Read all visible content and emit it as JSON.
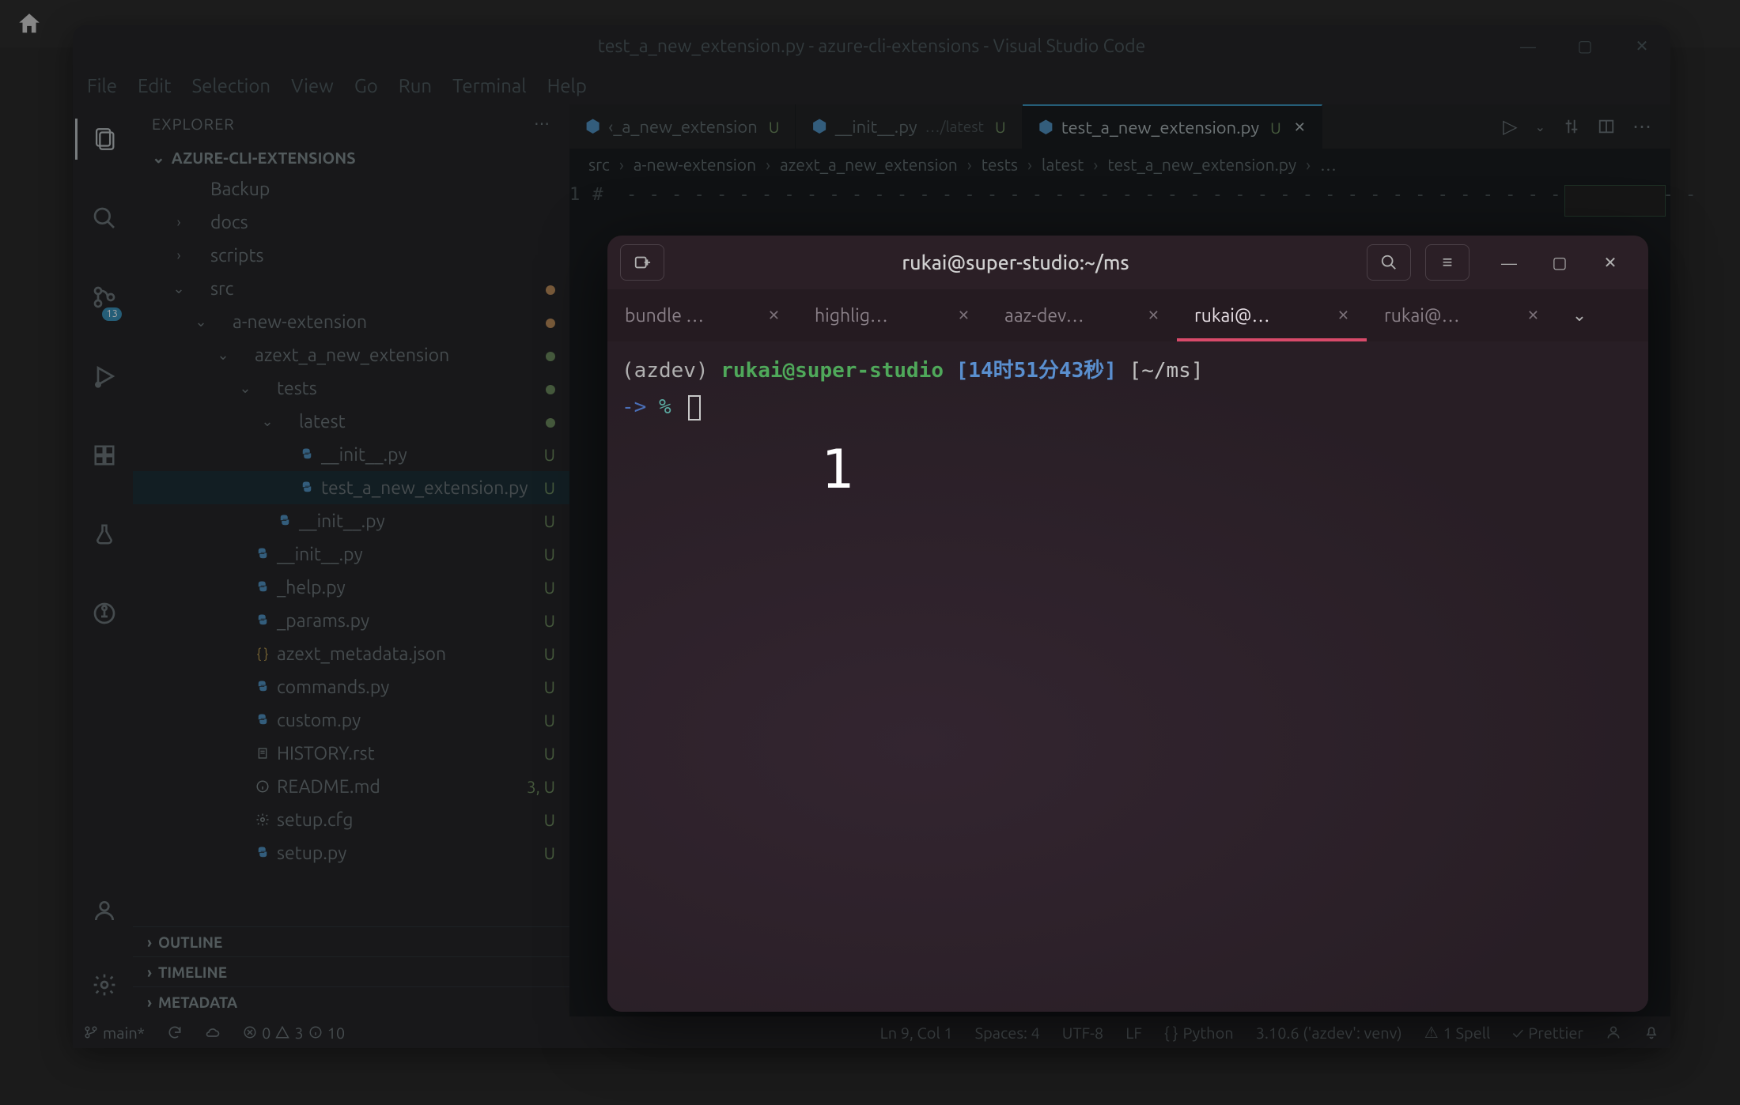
{
  "desktop": {
    "home_icon": "home"
  },
  "window": {
    "title": "test_a_new_extension.py - azure-cli-extensions - Visual Studio Code",
    "menu": [
      "File",
      "Edit",
      "Selection",
      "View",
      "Go",
      "Run",
      "Terminal",
      "Help"
    ]
  },
  "activitybar": {
    "scm_badge": "13"
  },
  "sidebar": {
    "header": "EXPLORER",
    "root": "AZURE-CLI-EXTENSIONS",
    "tree": [
      {
        "indent": 1,
        "chev": "",
        "icon": "",
        "name": "Backup",
        "decor": ""
      },
      {
        "indent": 1,
        "chev": "›",
        "icon": "",
        "name": "docs",
        "decor": ""
      },
      {
        "indent": 1,
        "chev": "›",
        "icon": "",
        "name": "scripts",
        "decor": ""
      },
      {
        "indent": 1,
        "chev": "⌄",
        "icon": "",
        "name": "src",
        "decor": "dot-orange"
      },
      {
        "indent": 2,
        "chev": "⌄",
        "icon": "",
        "name": "a-new-extension",
        "decor": "dot-orange"
      },
      {
        "indent": 3,
        "chev": "⌄",
        "icon": "",
        "name": "azext_a_new_extension",
        "decor": "dot-green"
      },
      {
        "indent": 4,
        "chev": "⌄",
        "icon": "",
        "name": "tests",
        "decor": "dot-green"
      },
      {
        "indent": 5,
        "chev": "⌄",
        "icon": "",
        "name": "latest",
        "decor": "dot-green"
      },
      {
        "indent": 6,
        "chev": "",
        "icon": "py",
        "name": "__init__.py",
        "decor": "U"
      },
      {
        "indent": 6,
        "chev": "",
        "icon": "py",
        "name": "test_a_new_extension.py",
        "decor": "U",
        "sel": true
      },
      {
        "indent": 5,
        "chev": "",
        "icon": "py",
        "name": "__init__.py",
        "decor": "U"
      },
      {
        "indent": 4,
        "chev": "",
        "icon": "py",
        "name": "__init__.py",
        "decor": "U"
      },
      {
        "indent": 4,
        "chev": "",
        "icon": "py",
        "name": "_help.py",
        "decor": "U"
      },
      {
        "indent": 4,
        "chev": "",
        "icon": "py",
        "name": "_params.py",
        "decor": "U"
      },
      {
        "indent": 4,
        "chev": "",
        "icon": "json",
        "name": "azext_metadata.json",
        "decor": "U"
      },
      {
        "indent": 4,
        "chev": "",
        "icon": "py",
        "name": "commands.py",
        "decor": "U"
      },
      {
        "indent": 4,
        "chev": "",
        "icon": "py",
        "name": "custom.py",
        "decor": "U"
      },
      {
        "indent": 4,
        "chev": "",
        "icon": "txt",
        "name": "HISTORY.rst",
        "decor": "U"
      },
      {
        "indent": 4,
        "chev": "",
        "icon": "info",
        "name": "README.md",
        "decor": "3, U"
      },
      {
        "indent": 4,
        "chev": "",
        "icon": "gear",
        "name": "setup.cfg",
        "decor": "U"
      },
      {
        "indent": 4,
        "chev": "",
        "icon": "py",
        "name": "setup.py",
        "decor": "U"
      }
    ],
    "collapsed": [
      "OUTLINE",
      "TIMELINE",
      "METADATA"
    ]
  },
  "tabs": [
    {
      "icon": "py",
      "label": "‹_a_new_extension",
      "suffix": "",
      "u": "U",
      "active": false,
      "close": false
    },
    {
      "icon": "py",
      "label": "__init__.py",
      "suffix": "…/latest",
      "u": "U",
      "active": false,
      "close": false
    },
    {
      "icon": "py",
      "label": "test_a_new_extension.py",
      "suffix": "",
      "u": "U",
      "active": true,
      "close": true
    }
  ],
  "crumbs": [
    "src",
    "a-new-extension",
    "azext_a_new_extension",
    "tests",
    "latest",
    "test_a_new_extension.py",
    "…"
  ],
  "editor": {
    "line_no": "1",
    "code": "#  - - - - - - - - - - - - - - - - - - - - - - - - - - - - - - - - - - - - - - - - - - - - - - - -"
  },
  "status": {
    "branch": "main*",
    "errors": "0",
    "warnings": "3",
    "info": "10",
    "pos": "Ln 9, Col 1",
    "spaces": "Spaces: 4",
    "enc": "UTF-8",
    "eol": "LF",
    "lang": "Python",
    "interp": "3.10.6 ('azdev': venv)",
    "spell": "1 Spell",
    "fmt": "Prettier"
  },
  "terminal": {
    "title": "rukai@super-studio:~/ms",
    "tabs": [
      {
        "label": "bundle …",
        "active": false
      },
      {
        "label": "highlig…",
        "active": false
      },
      {
        "label": "aaz-dev…",
        "active": false
      },
      {
        "label": "rukai@…",
        "active": true
      },
      {
        "label": "rukai@…",
        "active": false
      }
    ],
    "prompt": {
      "venv": "(azdev)",
      "user": "rukai@super-studio",
      "time": "[14时51分43秒]",
      "path": "[~/ms]"
    },
    "line2": {
      "arrow": "->",
      "pct": "%"
    },
    "overlay_num": "1"
  }
}
